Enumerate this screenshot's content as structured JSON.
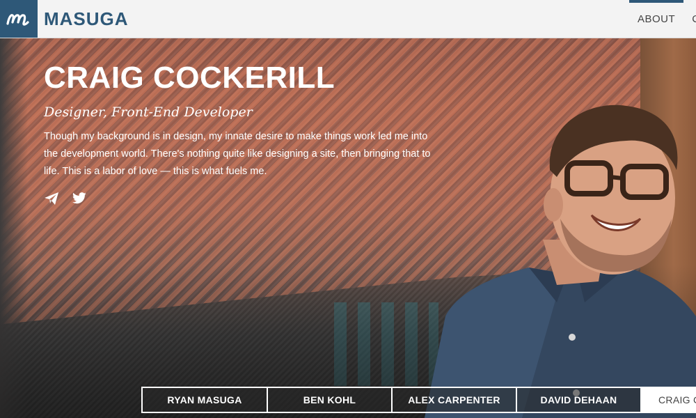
{
  "header": {
    "logo_icon": "masuga-m-logo",
    "brand": "MASUGA",
    "nav": [
      {
        "label": "ABOUT",
        "active": true
      },
      {
        "label": "C",
        "active": false
      }
    ]
  },
  "profile": {
    "name": "CRAIG COCKERILL",
    "role": "Designer, Front-End Developer",
    "bio": "Though my background is in design, my innate desire to make things work led me into the development world. There's nothing quite like designing a site, then bringing that to life. This is a labor of love — this is what fuels me.",
    "social": [
      {
        "icon": "paper-plane-icon"
      },
      {
        "icon": "twitter-icon"
      }
    ]
  },
  "team_tabs": [
    {
      "label": "RYAN MASUGA",
      "active": false
    },
    {
      "label": "BEN KOHL",
      "active": false
    },
    {
      "label": "ALEX CARPENTER",
      "active": false
    },
    {
      "label": "DAVID DEHAAN",
      "active": false
    },
    {
      "label": "CRAIG C",
      "active": true
    }
  ],
  "colors": {
    "brand": "#2e5878",
    "header_bg": "#f3f3f3"
  }
}
